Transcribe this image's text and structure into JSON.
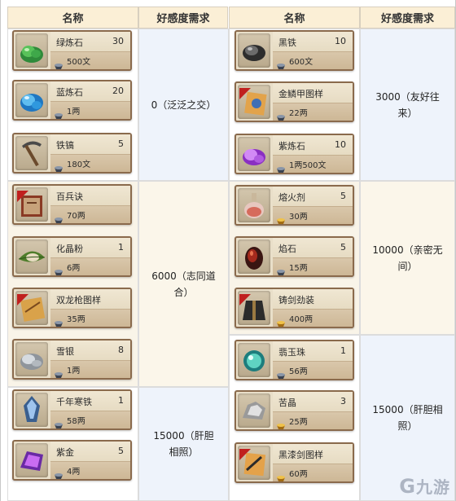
{
  "headers": {
    "name_left": "名称",
    "req_left": "好感度需求",
    "name_right": "名称",
    "req_right": "好感度需求"
  },
  "requirements_left": [
    "0（泛泛之交）",
    "6000（志同道合）",
    "15000（肝胆相照）"
  ],
  "requirements_right": [
    "3000（友好往来）",
    "10000（亲密无间）",
    "15000（肝胆相照）"
  ],
  "left_items": [
    {
      "name": "绿炼石",
      "qty": "30",
      "price": "500文",
      "icon": "green-stone-icon",
      "currency": "silver"
    },
    {
      "name": "蓝炼石",
      "qty": "20",
      "price": "1两",
      "icon": "blue-stone-icon",
      "currency": "silver"
    },
    {
      "name": "铁镐",
      "qty": "5",
      "price": "180文",
      "icon": "pickaxe-icon",
      "currency": "silver"
    },
    {
      "name": "百兵诀",
      "qty": "",
      "price": "70两",
      "icon": "manual-book-icon",
      "currency": "silver"
    },
    {
      "name": "化晶粉",
      "qty": "1",
      "price": "6两",
      "icon": "leaf-powder-icon",
      "currency": "silver"
    },
    {
      "name": "双龙枪图样",
      "qty": "",
      "price": "35两",
      "icon": "blueprint-scroll-icon",
      "currency": "silver"
    },
    {
      "name": "雪银",
      "qty": "8",
      "price": "1两",
      "icon": "silver-ore-icon",
      "currency": "silver"
    },
    {
      "name": "千年寒铁",
      "qty": "1",
      "price": "58两",
      "icon": "ice-iron-icon",
      "currency": "silver"
    },
    {
      "name": "紫金",
      "qty": "5",
      "price": "4两",
      "icon": "purple-gold-icon",
      "currency": "silver"
    }
  ],
  "right_items": [
    {
      "name": "黑铁",
      "qty": "10",
      "price": "600文",
      "icon": "black-iron-icon",
      "currency": "silver"
    },
    {
      "name": "金鳞甲图样",
      "qty": "",
      "price": "22两",
      "icon": "armor-blueprint-icon",
      "currency": "silver"
    },
    {
      "name": "紫炼石",
      "qty": "10",
      "price": "1两500文",
      "icon": "purple-stone-icon",
      "currency": "silver"
    },
    {
      "name": "熔火剂",
      "qty": "5",
      "price": "30两",
      "icon": "flask-icon",
      "currency": "gold"
    },
    {
      "name": "焰石",
      "qty": "5",
      "price": "15两",
      "icon": "flame-stone-icon",
      "currency": "silver"
    },
    {
      "name": "铸剑劲装",
      "qty": "",
      "price": "400两",
      "icon": "outfit-icon",
      "currency": "gold"
    },
    {
      "name": "翡玉珠",
      "qty": "1",
      "price": "56两",
      "icon": "jade-orb-icon",
      "currency": "silver"
    },
    {
      "name": "苦晶",
      "qty": "3",
      "price": "25两",
      "icon": "bitter-crystal-icon",
      "currency": "gold"
    },
    {
      "name": "黑漆剑图样",
      "qty": "",
      "price": "60两",
      "icon": "sword-blueprint-icon",
      "currency": "gold"
    }
  ],
  "watermark": {
    "glyph": "G",
    "text": "九游"
  },
  "colors": {
    "header_bg": "#fbefd6",
    "section_a": "#ffffff",
    "section_b": "#f9f4e8",
    "req_col_a": "#eef3fb",
    "req_col_b": "#fbf6ea",
    "card_border": "#8a6a4c"
  }
}
